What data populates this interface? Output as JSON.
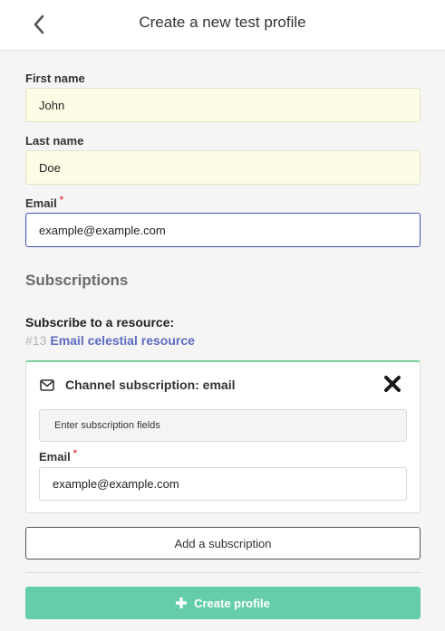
{
  "header": {
    "title": "Create a new test profile",
    "back_icon": "chevron-left-icon"
  },
  "form": {
    "first_name": {
      "label": "First name",
      "value": "John"
    },
    "last_name": {
      "label": "Last name",
      "value": "Doe"
    },
    "email": {
      "label": "Email",
      "required_mark": "*",
      "value": "example@example.com"
    }
  },
  "subscriptions": {
    "title": "Subscriptions",
    "resource_label": "Subscribe to a resource:",
    "resource_id": "#13",
    "resource_name": "Email celestial resource",
    "card": {
      "icon": "envelope-icon",
      "title": "Channel subscription: email",
      "close_icon": "close-icon",
      "fields_button": "Enter subscription fields",
      "email_label": "Email",
      "required_mark": "*",
      "email_value": "example@example.com"
    },
    "add_label": "Add a subscription"
  },
  "actions": {
    "create_label": "Create profile",
    "create_icon": "plus-icon"
  },
  "colors": {
    "accent_link": "#5c6bc0",
    "create_button": "#66cdac",
    "card_top_border": "#7ccf9b",
    "required": "#e04b4b",
    "focus_border": "#3f51b5"
  }
}
